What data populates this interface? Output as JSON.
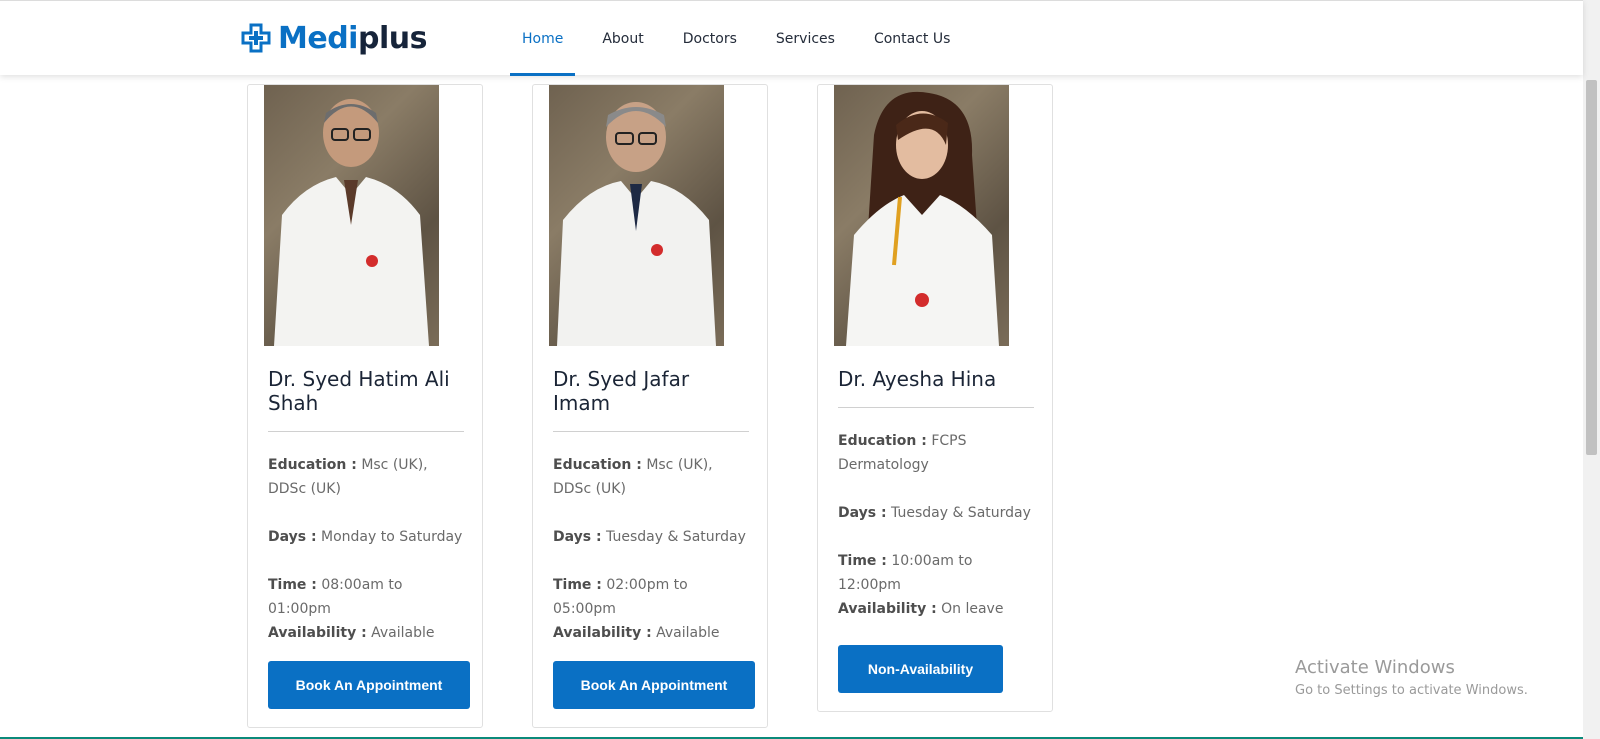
{
  "brand": {
    "part1": "Medi",
    "part2": "plus",
    "icon": "medical-cross-icon",
    "color": "#0a70c4"
  },
  "nav": [
    {
      "label": "Home",
      "active": true
    },
    {
      "label": "About"
    },
    {
      "label": "Doctors"
    },
    {
      "label": "Services"
    },
    {
      "label": "Contact Us"
    }
  ],
  "doctors": [
    {
      "name": "Dr. Syed Hatim Ali Shah",
      "education_label": "Education :",
      "education": "Msc (UK), DDSc (UK)",
      "days_label": "Days :",
      "days": "Monday to Saturday",
      "time_label": "Time :",
      "time": "08:00am to 01:00pm",
      "availability_label": "Availability :",
      "availability": "Available",
      "button": "Book An Appointment"
    },
    {
      "name": "Dr. Syed Jafar Imam",
      "education_label": "Education :",
      "education": "Msc (UK), DDSc (UK)",
      "days_label": "Days :",
      "days": "Tuesday & Saturday",
      "time_label": "Time :",
      "time": "02:00pm to 05:00pm",
      "availability_label": "Availability :",
      "availability": "Available",
      "button": "Book An Appointment"
    },
    {
      "name": "Dr. Ayesha Hina",
      "education_label": "Education :",
      "education": "FCPS Dermatology",
      "days_label": "Days :",
      "days": "Tuesday & Saturday",
      "time_label": "Time :",
      "time": "10:00am to 12:00pm",
      "availability_label": "Availability :",
      "availability": "On leave",
      "button": "Non-Availability"
    }
  ],
  "watermark": {
    "title": "Activate Windows",
    "subtitle": "Go to Settings to activate Windows."
  }
}
